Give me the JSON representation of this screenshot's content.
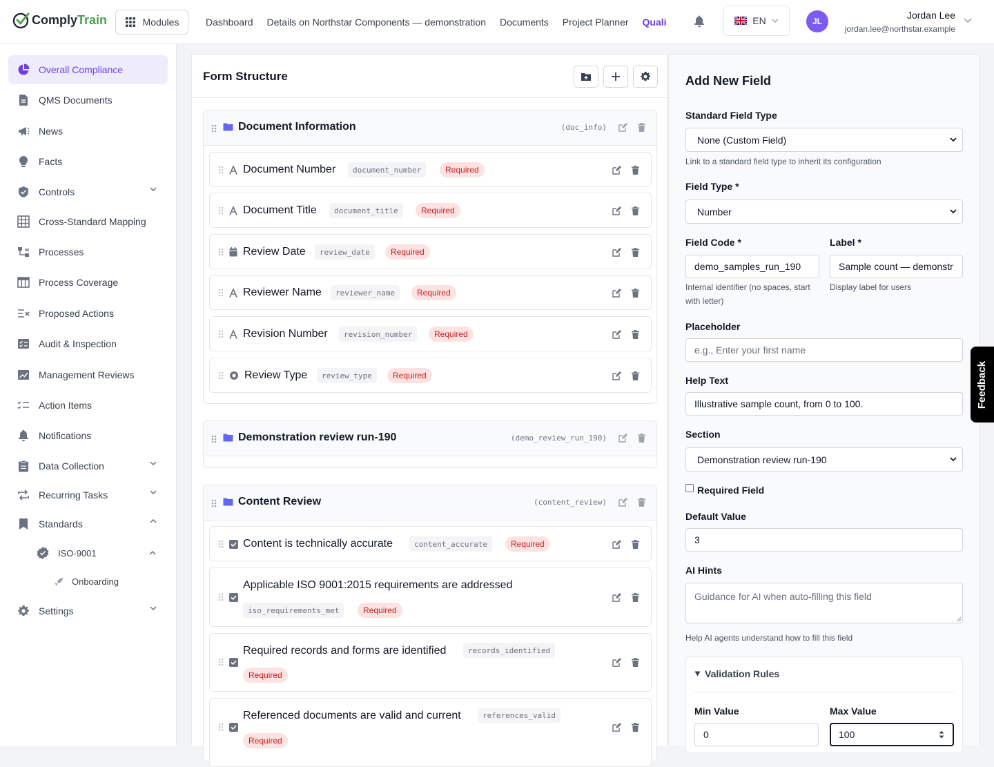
{
  "brand": {
    "name_part1": "Comply",
    "name_part2": "Train"
  },
  "topbar": {
    "modules_label": "Modules",
    "nav": [
      "Dashboard",
      "Details on Northstar Components — demonstration",
      "Documents",
      "Project Planner",
      "Quali"
    ],
    "language": "EN",
    "user": {
      "initials": "JL",
      "name": "Jordan Lee",
      "email": "jordan.lee@northstar.example"
    }
  },
  "sidebar": {
    "items": [
      {
        "label": "Overall Compliance",
        "icon": "pie-chart-icon"
      },
      {
        "label": "QMS Documents",
        "icon": "document-icon"
      },
      {
        "label": "News",
        "icon": "megaphone-icon"
      },
      {
        "label": "Facts",
        "icon": "lightbulb-icon"
      },
      {
        "label": "Controls",
        "icon": "shield-icon"
      },
      {
        "label": "Cross-Standard Mapping",
        "icon": "grid-icon"
      },
      {
        "label": "Processes",
        "icon": "flow-icon"
      },
      {
        "label": "Process Coverage",
        "icon": "table-icon"
      },
      {
        "label": "Proposed Actions",
        "icon": "list-x-icon"
      },
      {
        "label": "Audit & Inspection",
        "icon": "checklist-icon"
      },
      {
        "label": "Management Reviews",
        "icon": "chart-box-icon"
      },
      {
        "label": "Action Items",
        "icon": "tasks-icon"
      },
      {
        "label": "Notifications",
        "icon": "bell-icon"
      },
      {
        "label": "Data Collection",
        "icon": "clipboard-icon"
      },
      {
        "label": "Recurring Tasks",
        "icon": "repeat-icon"
      },
      {
        "label": "Standards",
        "icon": "bookmark-icon"
      },
      {
        "label": "Settings",
        "icon": "gear-icon"
      }
    ],
    "standard_sub": "ISO-9001",
    "standard_sub_sub": "Onboarding"
  },
  "form": {
    "title": "Form Structure",
    "sections": [
      {
        "title": "Document Information",
        "code": "(doc_info)",
        "fields": [
          {
            "label": "Document Number",
            "code": "document_number",
            "badge": "Required"
          },
          {
            "label": "Document Title",
            "code": "document_title",
            "badge": "Required"
          },
          {
            "label": "Review Date",
            "code": "review_date",
            "badge": "Required"
          },
          {
            "label": "Reviewer Name",
            "code": "reviewer_name",
            "badge": "Required"
          },
          {
            "label": "Revision Number",
            "code": "revision_number",
            "badge": "Required"
          },
          {
            "label": "Review Type",
            "code": "review_type",
            "badge": "Required"
          }
        ]
      },
      {
        "title": "Demonstration review run-190",
        "code": "(demo_review_run_190)",
        "fields": []
      },
      {
        "title": "Content Review",
        "code": "(content_review)",
        "fields": [
          {
            "label": "Content is technically accurate",
            "code": "content_accurate",
            "badge": "Required"
          },
          {
            "label": "Applicable ISO 9001:2015 requirements are addressed",
            "code": "iso_requirements_met",
            "badge": "Required"
          },
          {
            "label": "Required records and forms are identified",
            "code": "records_identified",
            "badge": "Required"
          },
          {
            "label": "Referenced documents are valid and current",
            "code": "references_valid",
            "badge": "Required"
          }
        ]
      }
    ]
  },
  "add_field": {
    "title": "Add New Field",
    "standard_type": {
      "label": "Standard Field Type",
      "value": "None (Custom Field)",
      "hint": "Link to a standard field type to inherit its configuration"
    },
    "field_type": {
      "label": "Field Type *",
      "value": "Number"
    },
    "field_code": {
      "label": "Field Code *",
      "value": "demo_samples_run_190",
      "hint": "Internal identifier (no spaces, start with letter)"
    },
    "display_label": {
      "label": "Label *",
      "value": "Sample count — demonstr",
      "hint": "Display label for users"
    },
    "placeholder": {
      "label": "Placeholder",
      "placeholder": "e.g., Enter your first name"
    },
    "help_text": {
      "label": "Help Text",
      "value": "Illustrative sample count, from 0 to 100."
    },
    "section": {
      "label": "Section",
      "value": "Demonstration review run-190"
    },
    "required": {
      "label": "Required Field"
    },
    "default_value": {
      "label": "Default Value",
      "value": "3"
    },
    "ai_hints": {
      "label": "AI Hints",
      "placeholder": "Guidance for AI when auto-filling this field",
      "hint": "Help AI agents understand how to fill this field"
    },
    "validation": {
      "title": "Validation Rules",
      "min_label": "Min Value",
      "min_value": "0",
      "max_label": "Max Value",
      "max_value": "100"
    }
  },
  "feedback_label": "Feedback",
  "colors": {
    "accent": "#6d3fe0",
    "brand_green": "#4aa350",
    "required_bg": "#fde2e2",
    "required_text": "#c81e1e",
    "folder": "#6366f1"
  }
}
